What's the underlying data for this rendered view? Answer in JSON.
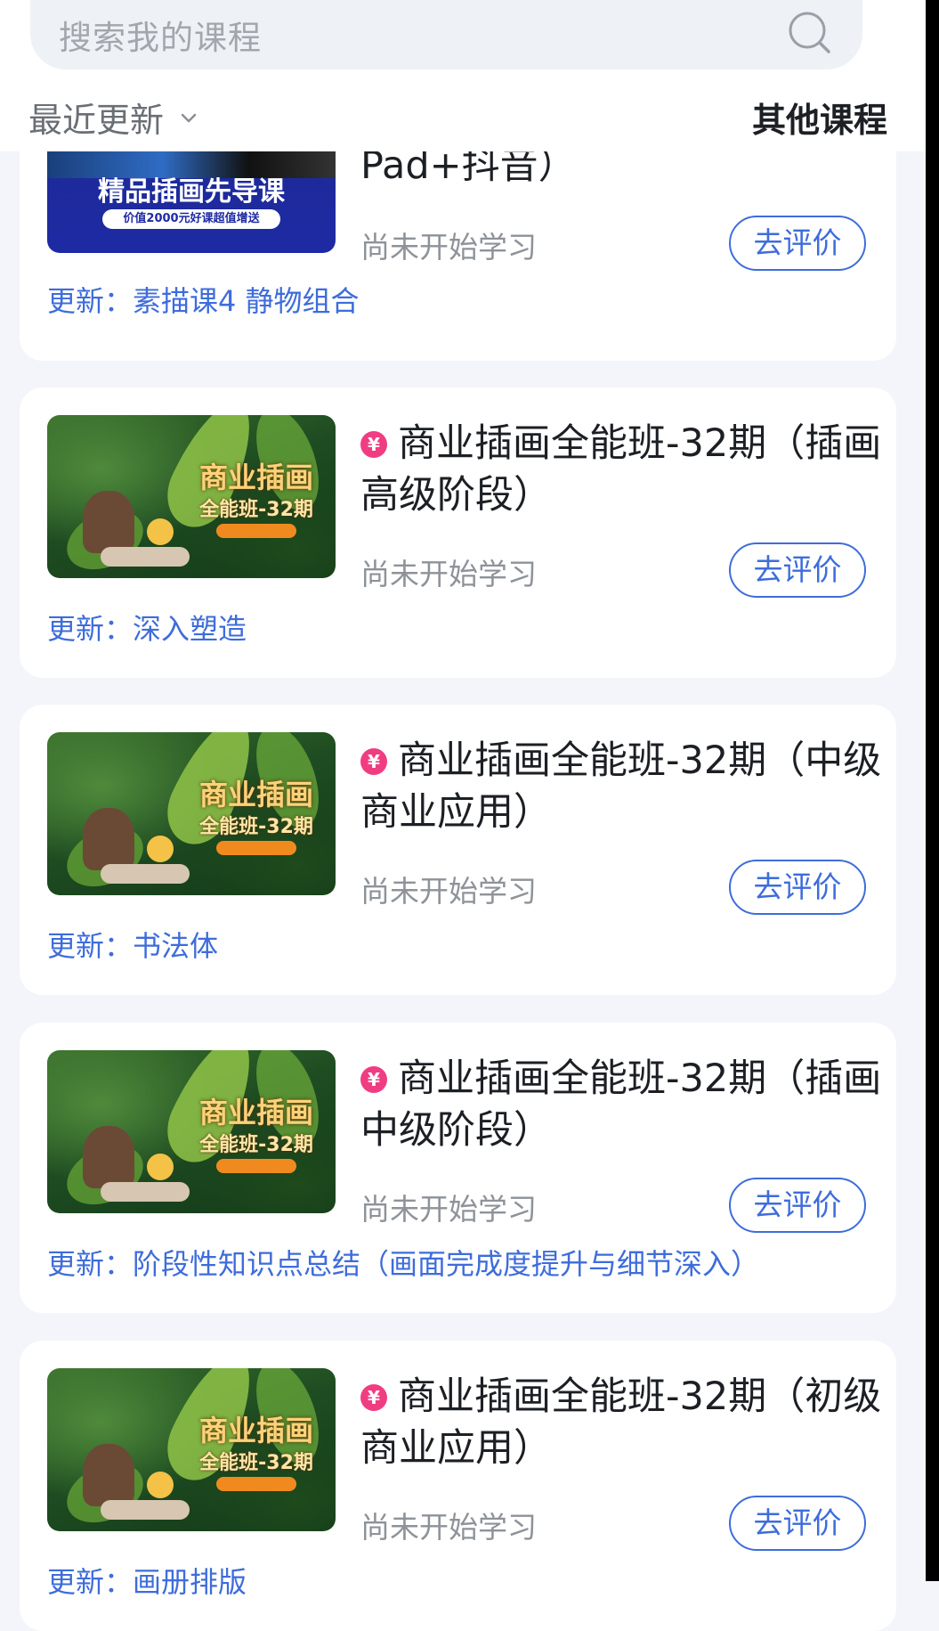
{
  "search": {
    "placeholder": "搜索我的课程",
    "icon": "search-icon"
  },
  "filter": {
    "sort_label": "最近更新",
    "other_label": "其他课程"
  },
  "colors": {
    "accent": "#3e6cdb",
    "coin": "#f03d82",
    "background": "#f3f5fa"
  },
  "courses": [
    {
      "title": "Pad+抖音）",
      "thumb_title": "精品插画先导课",
      "thumb_sub": "价值2000元好课超值增送",
      "status": "尚未开始学习",
      "action": "去评价",
      "update": "更新：素描课4 静物组合"
    },
    {
      "coin": "¥",
      "title": "商业插画全能班-32期（插画高级阶段）",
      "thumb_title": "商业插画",
      "thumb_sub": "全能班-32期",
      "status": "尚未开始学习",
      "action": "去评价",
      "update": "更新：深入塑造"
    },
    {
      "coin": "¥",
      "title": "商业插画全能班-32期（中级商业应用）",
      "thumb_title": "商业插画",
      "thumb_sub": "全能班-32期",
      "status": "尚未开始学习",
      "action": "去评价",
      "update": "更新：书法体"
    },
    {
      "coin": "¥",
      "title": "商业插画全能班-32期（插画中级阶段）",
      "thumb_title": "商业插画",
      "thumb_sub": "全能班-32期",
      "status": "尚未开始学习",
      "action": "去评价",
      "update": "更新：阶段性知识点总结（画面完成度提升与细节深入）"
    },
    {
      "coin": "¥",
      "title": "商业插画全能班-32期（初级商业应用）",
      "thumb_title": "商业插画",
      "thumb_sub": "全能班-32期",
      "status": "尚未开始学习",
      "action": "去评价",
      "update": "更新：画册排版"
    }
  ]
}
